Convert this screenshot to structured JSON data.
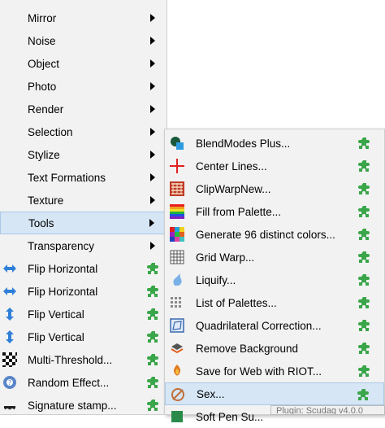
{
  "menu1": {
    "items": [
      {
        "label": "Mirror"
      },
      {
        "label": "Noise"
      },
      {
        "label": "Object"
      },
      {
        "label": "Photo"
      },
      {
        "label": "Render"
      },
      {
        "label": "Selection"
      },
      {
        "label": "Stylize"
      },
      {
        "label": "Text Formations"
      },
      {
        "label": "Texture"
      },
      {
        "label": "Tools"
      },
      {
        "label": "Transparency"
      },
      {
        "label": "Flip Horizontal"
      },
      {
        "label": "Flip Horizontal"
      },
      {
        "label": "Flip Vertical"
      },
      {
        "label": "Flip Vertical"
      },
      {
        "label": "Multi-Threshold..."
      },
      {
        "label": "Random Effect..."
      },
      {
        "label": "Signature stamp..."
      }
    ]
  },
  "menu2": {
    "items": [
      {
        "label": "BlendModes Plus..."
      },
      {
        "label": "Center Lines..."
      },
      {
        "label": "ClipWarpNew..."
      },
      {
        "label": "Fill from Palette..."
      },
      {
        "label": "Generate 96 distinct colors..."
      },
      {
        "label": "Grid Warp..."
      },
      {
        "label": "Liquify..."
      },
      {
        "label": "List of Palettes..."
      },
      {
        "label": "Quadrilateral Correction..."
      },
      {
        "label": "Remove Background"
      },
      {
        "label": "Save for Web with RIOT..."
      },
      {
        "label": "Sex..."
      },
      {
        "label": "Soft Pen Su..."
      }
    ]
  },
  "tooltip": {
    "text": "Plugin: Scudag v4.0.0"
  },
  "colors": {
    "highlight": "#d6e6f5",
    "menu_bg": "#f2f2f2",
    "plugin_green": "#3aa64a"
  }
}
